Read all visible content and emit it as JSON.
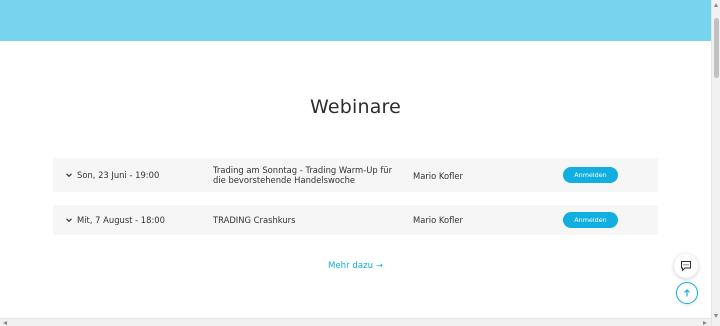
{
  "section": {
    "title": "Webinare"
  },
  "webinars": [
    {
      "date": "Son, 23 Juni - 19:00",
      "title": "Trading am Sonntag - Trading Warm-Up für die bevorstehende Handelswoche",
      "host": "Mario Kofler",
      "button": "Anmelden"
    },
    {
      "date": "Mit, 7 August - 18:00",
      "title": "TRADING Crashkurs",
      "host": "Mario Kofler",
      "button": "Anmelden"
    }
  ],
  "more_link": "Mehr dazu →",
  "colors": {
    "accent": "#11aee0",
    "header_band": "#78d3ef",
    "row_bg": "#f6f6f6"
  },
  "icons": {
    "expand": "chevron-down-icon",
    "chat": "chat-bubble-icon",
    "scroll_top": "arrow-up-icon"
  }
}
